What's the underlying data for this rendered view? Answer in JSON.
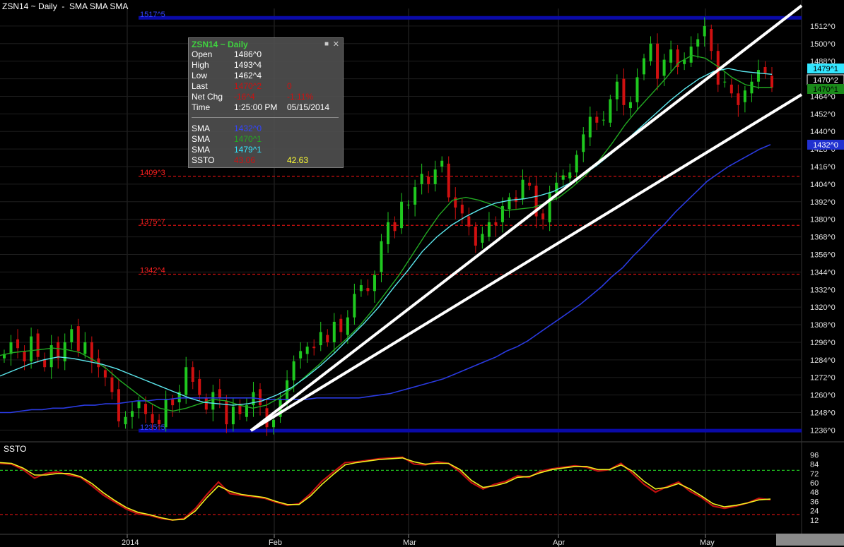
{
  "window_title": "ZSN14 ~ Daily  -  SMA SMA SMA",
  "tooltip": {
    "header": "ZSN14 ~ Daily",
    "pin_icon": "pin-icon",
    "close_icon": "close-icon",
    "rows": [
      {
        "label": "Open",
        "value": "1486^0",
        "value2": "",
        "color": "#ffffff"
      },
      {
        "label": "High",
        "value": "1493^4",
        "value2": "",
        "color": "#ffffff"
      },
      {
        "label": "Low",
        "value": "1462^4",
        "value2": "",
        "color": "#ffffff"
      },
      {
        "label": "Last",
        "value": "1470^2",
        "value2": "0",
        "color": "#cc1111"
      },
      {
        "label": "Net Chg",
        "value": "-16^4",
        "value2": "-1.11%",
        "color": "#cc1111"
      },
      {
        "label": "Time",
        "value": "1:25:00 PM",
        "value2": "05/15/2014",
        "color": "#ffffff"
      }
    ],
    "indicators": [
      {
        "label": "SMA",
        "value": "1432^0",
        "value2": "",
        "color": "#3344ff"
      },
      {
        "label": "SMA",
        "value": "1470^1",
        "value2": "",
        "color": "#22aa22"
      },
      {
        "label": "SMA",
        "value": "1479^1",
        "value2": "",
        "color": "#33e6ff"
      },
      {
        "label": "SSTO",
        "value": "43.06",
        "value2": "42.63",
        "color": "#cc1111",
        "color2": "#ffff33"
      }
    ]
  },
  "price_axis_labels": [
    "1512^0",
    "1500^0",
    "1488^0",
    "1476^0",
    "1464^0",
    "1452^0",
    "1440^0",
    "1428^0",
    "1416^0",
    "1404^0",
    "1392^0",
    "1380^0",
    "1368^0",
    "1356^0",
    "1344^0",
    "1332^0",
    "1320^0",
    "1308^0",
    "1296^0",
    "1284^0",
    "1272^0",
    "1260^0",
    "1248^0",
    "1236^0"
  ],
  "price_flags": [
    {
      "text": "1479^1",
      "color": "#33e6ff",
      "text_color": "#000000"
    },
    {
      "text": "1470^2",
      "color": "#000000",
      "text_color": "#ffffff"
    },
    {
      "text": "1470^1",
      "color": "#1a8a1a",
      "text_color": "#000000"
    },
    {
      "text": "1432^0",
      "color": "#2030d0",
      "text_color": "#ffffff"
    }
  ],
  "hlines": [
    {
      "label": "1517^5",
      "color": "#0a0aa8",
      "style": "solid-thick"
    },
    {
      "label": "1409^3",
      "color": "#d01010",
      "style": "dashed"
    },
    {
      "label": "1375^7",
      "color": "#d01010",
      "style": "dashed"
    },
    {
      "label": "1342^4",
      "color": "#d01010",
      "style": "dashed"
    },
    {
      "label": "1235^5",
      "color": "#0a0aa8",
      "style": "solid-thick"
    }
  ],
  "ssto_panel": {
    "title": "SSTO",
    "axis_labels": [
      "96",
      "84",
      "72",
      "60",
      "48",
      "36",
      "24",
      "12"
    ],
    "upper_level": 76,
    "lower_level": 19
  },
  "time_axis": [
    "2014",
    "Feb",
    "Mar",
    "Apr",
    "May"
  ],
  "colors": {
    "up": "#1fc81f",
    "down": "#d01010",
    "sma_long": "#2a3ae0",
    "sma_mid": "#22aa22",
    "sma_short": "#5ce8ee",
    "ssto_k": "#c01010",
    "ssto_d": "#f0f020",
    "trendline": "#ffffff"
  },
  "chart_data": {
    "type": "line",
    "title": "ZSN14 ~ Daily",
    "ylim": [
      1228,
      1524
    ],
    "ohlc_sample_last": {
      "open": 1486.0,
      "high": 1493.5,
      "low": 1462.5,
      "close": 1470.25
    },
    "closes": [
      1288,
      1296,
      1292,
      1283,
      1300,
      1286,
      1279,
      1294,
      1285,
      1296,
      1305,
      1290,
      1296,
      1283,
      1279,
      1272,
      1262,
      1242,
      1245,
      1249,
      1256,
      1247,
      1241,
      1240,
      1257,
      1253,
      1262,
      1279,
      1269,
      1260,
      1250,
      1262,
      1258,
      1240,
      1252,
      1247,
      1253,
      1262,
      1253,
      1238,
      1243,
      1257,
      1270,
      1283,
      1290,
      1293,
      1292,
      1303,
      1296,
      1310,
      1303,
      1313,
      1329,
      1335,
      1331,
      1342,
      1365,
      1378,
      1372,
      1392,
      1390,
      1402,
      1411,
      1404,
      1414,
      1420,
      1395,
      1388,
      1384,
      1375,
      1362,
      1370,
      1378,
      1376,
      1389,
      1395,
      1392,
      1407,
      1403,
      1382,
      1380,
      1398,
      1405,
      1410,
      1412,
      1424,
      1438,
      1450,
      1446,
      1448,
      1462,
      1474,
      1458,
      1460,
      1477,
      1490,
      1500,
      1476,
      1489,
      1496,
      1484,
      1489,
      1498,
      1503,
      1512,
      1495,
      1472,
      1474,
      1466,
      1458,
      1468,
      1474,
      1482,
      1480,
      1470
    ],
    "sma_long": [
      1248,
      1248,
      1249,
      1250,
      1250,
      1251,
      1251,
      1252,
      1253,
      1253,
      1254,
      1254,
      1255,
      1256,
      1256,
      1257,
      1257,
      1258,
      1258,
      1258,
      1258,
      1258,
      1258,
      1258,
      1258,
      1257,
      1257,
      1257,
      1257,
      1257,
      1258,
      1258,
      1258,
      1258,
      1258,
      1259,
      1260,
      1261,
      1263,
      1265,
      1267,
      1269,
      1271,
      1274,
      1277,
      1280,
      1283,
      1286,
      1290,
      1293,
      1297,
      1302,
      1307,
      1312,
      1317,
      1322,
      1328,
      1334,
      1341,
      1347,
      1355,
      1362,
      1370,
      1377,
      1385,
      1392,
      1399,
      1406,
      1411,
      1416,
      1420,
      1424,
      1428,
      1431
    ],
    "sma_mid": [
      1287,
      1289,
      1290,
      1291,
      1292,
      1291,
      1289,
      1284,
      1278,
      1270,
      1263,
      1256,
      1251,
      1249,
      1251,
      1254,
      1257,
      1256,
      1253,
      1251,
      1253,
      1258,
      1265,
      1273,
      1281,
      1290,
      1298,
      1307,
      1318,
      1330,
      1342,
      1356,
      1370,
      1383,
      1393,
      1395,
      1393,
      1390,
      1386,
      1387,
      1388,
      1391,
      1395,
      1402,
      1410,
      1420,
      1432,
      1445,
      1456,
      1466,
      1476,
      1487,
      1492,
      1490,
      1484,
      1477,
      1472,
      1470,
      1470
    ],
    "sma_short": [
      1273,
      1277,
      1281,
      1284,
      1286,
      1285,
      1283,
      1281,
      1278,
      1274,
      1270,
      1266,
      1262,
      1258,
      1255,
      1254,
      1253,
      1254,
      1256,
      1260,
      1265,
      1272,
      1280,
      1289,
      1299,
      1309,
      1320,
      1333,
      1345,
      1358,
      1368,
      1376,
      1382,
      1387,
      1391,
      1393,
      1394,
      1396,
      1399,
      1404,
      1410,
      1417,
      1425,
      1434,
      1443,
      1452,
      1461,
      1469,
      1476,
      1481,
      1483,
      1481,
      1480,
      1479
    ],
    "ssto_k": [
      85,
      84,
      77,
      66,
      72,
      74,
      70,
      67,
      56,
      44,
      35,
      26,
      20,
      18,
      14,
      12,
      14,
      27,
      45,
      61,
      46,
      44,
      42,
      40,
      35,
      31,
      33,
      46,
      62,
      74,
      86,
      87,
      89,
      91,
      92,
      93,
      84,
      83,
      87,
      85,
      74,
      60,
      52,
      58,
      62,
      69,
      67,
      75,
      78,
      80,
      82,
      80,
      75,
      77,
      85,
      72,
      58,
      48,
      55,
      61,
      49,
      41,
      30,
      27,
      30,
      34,
      40,
      38
    ],
    "ssto_d": [
      86,
      85,
      79,
      70,
      70,
      72,
      72,
      68,
      59,
      47,
      37,
      28,
      22,
      19,
      15,
      12,
      13,
      24,
      41,
      56,
      49,
      45,
      43,
      41,
      36,
      32,
      32,
      43,
      58,
      71,
      83,
      86,
      88,
      90,
      91,
      92,
      87,
      84,
      85,
      85,
      77,
      63,
      54,
      56,
      60,
      67,
      68,
      73,
      77,
      79,
      81,
      81,
      77,
      77,
      83,
      75,
      62,
      52,
      54,
      59,
      52,
      43,
      33,
      29,
      31,
      34,
      38,
      39
    ]
  }
}
